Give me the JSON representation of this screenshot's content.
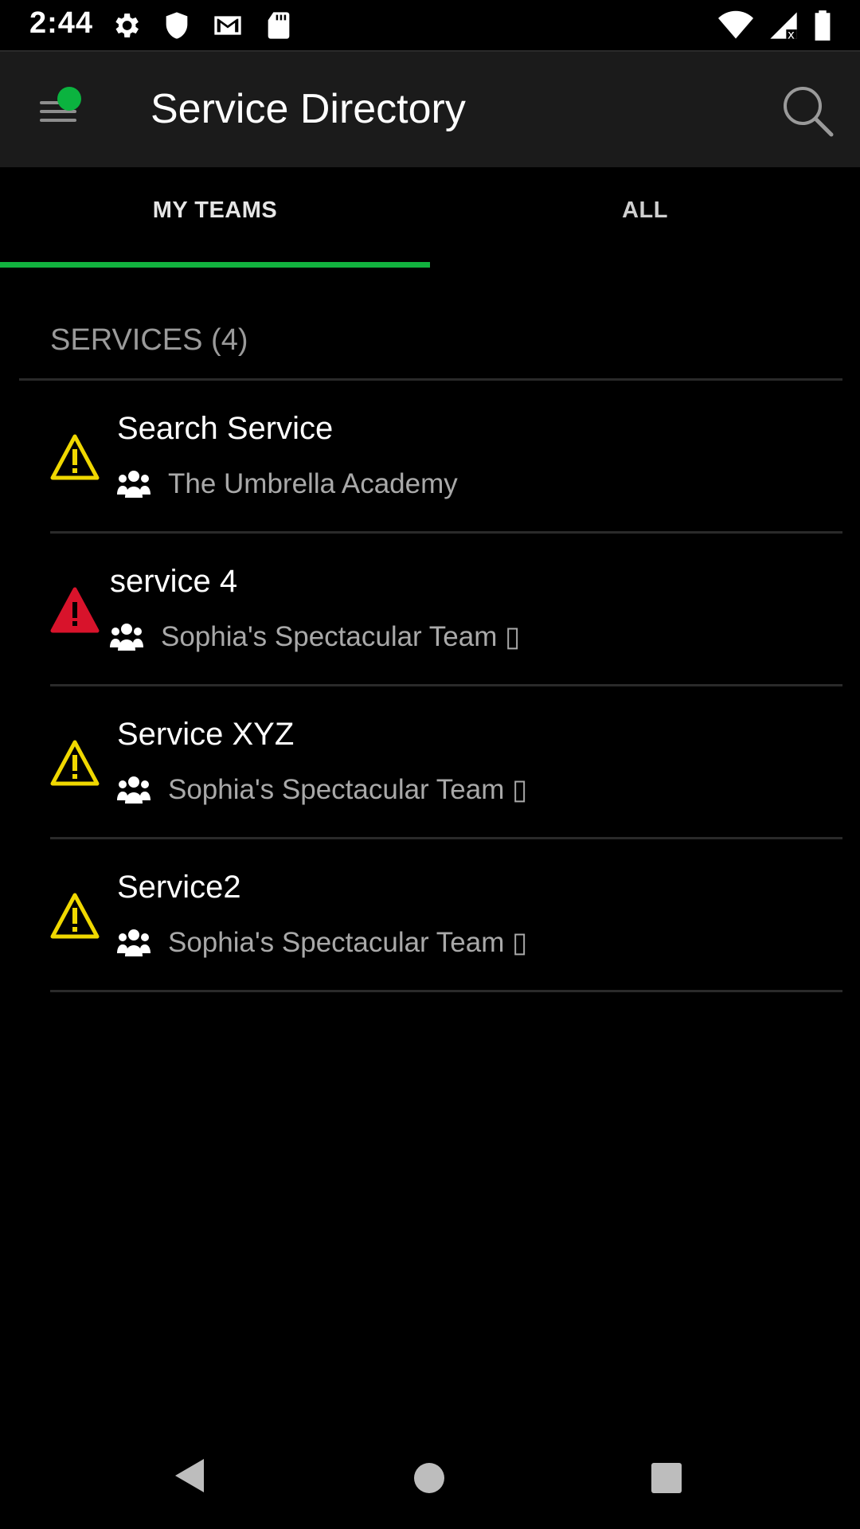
{
  "status_bar": {
    "time": "2:44",
    "left_icons": [
      "gear-icon",
      "shield-icon",
      "gmail-icon",
      "sd-card-icon"
    ],
    "right_icons": [
      "wifi-icon",
      "cellular-no-data-icon",
      "battery-icon"
    ]
  },
  "app_bar": {
    "title": "Service Directory",
    "menu_icon": "hamburger-menu-icon",
    "status_dot_color": "#0bb33f",
    "search_icon": "search-icon"
  },
  "tabs": [
    {
      "label": "MY TEAMS",
      "selected": true
    },
    {
      "label": "ALL",
      "selected": false
    }
  ],
  "accent_color": "#12b23f",
  "section": {
    "label": "SERVICES (4)"
  },
  "services": [
    {
      "name": "Search Service",
      "team": "The Umbrella Academy",
      "status": "warning",
      "status_color": "#f0d800"
    },
    {
      "name": "service 4",
      "team": "Sophia's Spectacular Team ▯",
      "status": "critical",
      "status_color": "#d8132b"
    },
    {
      "name": "Service XYZ",
      "team": "Sophia's Spectacular Team ▯",
      "status": "warning",
      "status_color": "#f0d800"
    },
    {
      "name": "Service2",
      "team": "Sophia's Spectacular Team ▯",
      "status": "warning",
      "status_color": "#f0d800"
    }
  ],
  "nav_bar": {
    "icons": [
      "back-icon",
      "home-icon",
      "recent-apps-icon"
    ]
  }
}
